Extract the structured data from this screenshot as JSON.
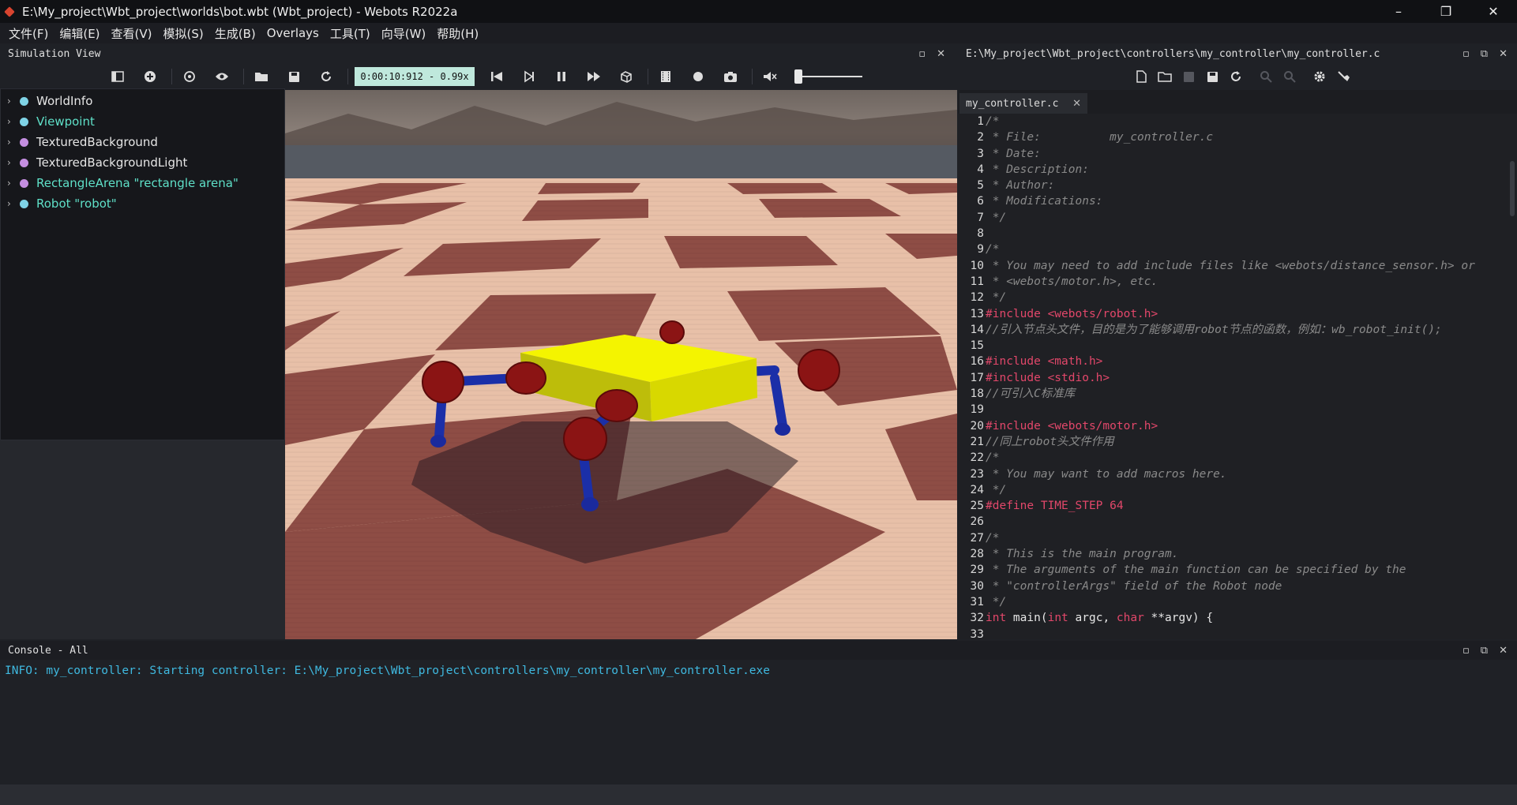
{
  "window": {
    "title": "E:\\My_project\\Wbt_project\\worlds\\bot.wbt (Wbt_project) - Webots R2022a",
    "controls": [
      "–",
      "❐",
      "✕"
    ]
  },
  "menu": [
    "文件(F)",
    "编辑(E)",
    "查看(V)",
    "模拟(S)",
    "生成(B)",
    "Overlays",
    "工具(T)",
    "向导(W)",
    "帮助(H)"
  ],
  "simulation_view": {
    "title": "Simulation View",
    "time": "0:00:10:912  - 0.99x"
  },
  "scene_tree": [
    {
      "label": "WorldInfo",
      "color": "#e6e6e6",
      "dot": "#7fd3e6"
    },
    {
      "label": "Viewpoint",
      "color": "#5fe0c8",
      "dot": "#7fd3e6"
    },
    {
      "label": "TexturedBackground",
      "color": "#e6e6e6",
      "dot": "#c48ee0"
    },
    {
      "label": "TexturedBackgroundLight",
      "color": "#e6e6e6",
      "dot": "#c48ee0"
    },
    {
      "label": "RectangleArena \"rectangle arena\"",
      "color": "#5fe0c8",
      "dot": "#c48ee0"
    },
    {
      "label": "Robot \"robot\"",
      "color": "#5fe0c8",
      "dot": "#7fd3e6"
    }
  ],
  "editor": {
    "path": "E:\\My_project\\Wbt_project\\controllers\\my_controller\\my_controller.c",
    "tab": "my_controller.c",
    "lines": [
      [
        {
          "t": "/*",
          "c": "comment"
        }
      ],
      [
        {
          "t": " * File:          my_controller.c",
          "c": "comment"
        }
      ],
      [
        {
          "t": " * Date:",
          "c": "comment"
        }
      ],
      [
        {
          "t": " * Description:",
          "c": "comment"
        }
      ],
      [
        {
          "t": " * Author:",
          "c": "comment"
        }
      ],
      [
        {
          "t": " * Modifications:",
          "c": "comment"
        }
      ],
      [
        {
          "t": " */",
          "c": "comment"
        }
      ],
      [],
      [
        {
          "t": "/*",
          "c": "comment"
        }
      ],
      [
        {
          "t": " * You may need to add include files like <webots/distance_sensor.h> or",
          "c": "comment"
        }
      ],
      [
        {
          "t": " * <webots/motor.h>, etc.",
          "c": "comment"
        }
      ],
      [
        {
          "t": " */",
          "c": "comment"
        }
      ],
      [
        {
          "t": "#include <webots/robot.h>",
          "c": "pre"
        }
      ],
      [
        {
          "t": "//引入节点头文件，目的是为了能够调用robot节点的函数，例如：wb_robot_init();",
          "c": "comment"
        }
      ],
      [],
      [
        {
          "t": "#include <math.h>",
          "c": "pre"
        }
      ],
      [
        {
          "t": "#include <stdio.h>",
          "c": "pre"
        }
      ],
      [
        {
          "t": "//可引入C标准库",
          "c": "comment"
        }
      ],
      [],
      [
        {
          "t": "#include <webots/motor.h>",
          "c": "pre"
        }
      ],
      [
        {
          "t": "//同上robot头文件作用",
          "c": "comment"
        }
      ],
      [
        {
          "t": "/*",
          "c": "comment"
        }
      ],
      [
        {
          "t": " * You may want to add macros here.",
          "c": "comment"
        }
      ],
      [
        {
          "t": " */",
          "c": "comment"
        }
      ],
      [
        {
          "t": "#define TIME_STEP 64",
          "c": "pre"
        }
      ],
      [],
      [
        {
          "t": "/*",
          "c": "comment"
        }
      ],
      [
        {
          "t": " * This is the main program.",
          "c": "comment"
        }
      ],
      [
        {
          "t": " * The arguments of the main function can be specified by the",
          "c": "comment"
        }
      ],
      [
        {
          "t": " * \"controllerArgs\" field of the Robot node",
          "c": "comment"
        }
      ],
      [
        {
          "t": " */",
          "c": "comment"
        }
      ],
      [
        {
          "t": "int",
          "c": "kw"
        },
        {
          "t": " main(",
          "c": "plain"
        },
        {
          "t": "int",
          "c": "kw"
        },
        {
          "t": " argc, ",
          "c": "plain"
        },
        {
          "t": "char",
          "c": "kw"
        },
        {
          "t": " **argv) {",
          "c": "plain"
        }
      ],
      []
    ]
  },
  "console": {
    "title": "Console - All",
    "lines": [
      "INFO: my_controller: Starting controller: E:\\My_project\\Wbt_project\\controllers\\my_controller\\my_controller.exe"
    ]
  },
  "colors": {
    "accent_tree": "#5fe0c8",
    "preprocessor": "#e2476a",
    "comment": "#8a8a8a",
    "console_info": "#3fb9e0",
    "robot_body": "#f4f400",
    "robot_joint": "#8b1414",
    "robot_leg": "#1b2fa8"
  }
}
